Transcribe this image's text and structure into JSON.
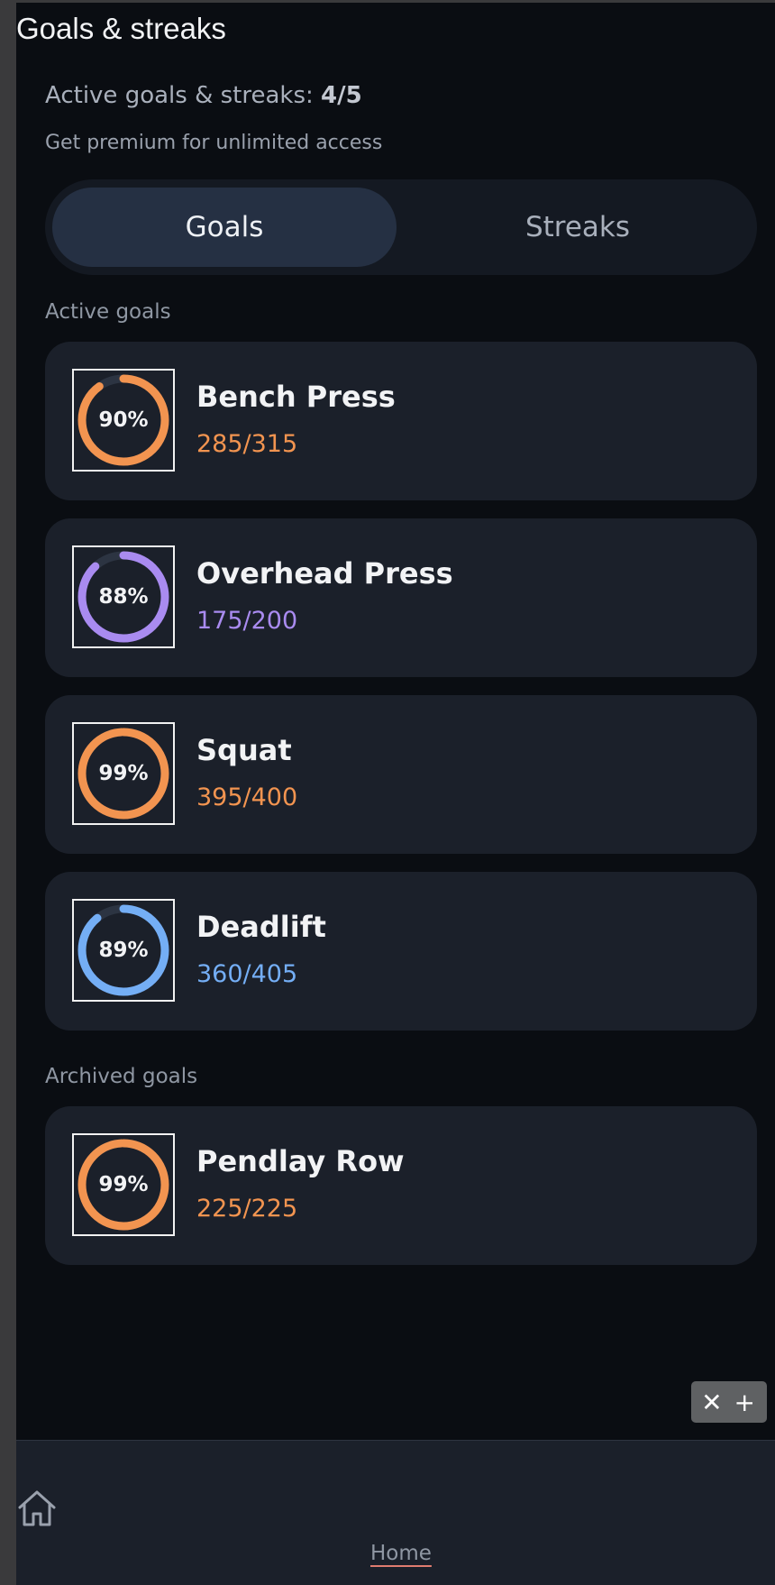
{
  "header": {
    "title": "Goals & streaks"
  },
  "quota": {
    "label": "Active goals & streaks:",
    "value": "4/5"
  },
  "premium_text": "Get premium for unlimited access",
  "tabs": {
    "goals": "Goals",
    "streaks": "Streaks",
    "selected": "Goals"
  },
  "sections": {
    "active": "Active goals",
    "archived": "Archived goals"
  },
  "active_goals": [
    {
      "name": "Bench Press",
      "value": "285/315",
      "percent_label": "90%",
      "progress": 0.9,
      "color": "#f29450"
    },
    {
      "name": "Overhead Press",
      "value": "175/200",
      "percent_label": "88%",
      "progress": 0.88,
      "color": "#a98bf0"
    },
    {
      "name": "Squat",
      "value": "395/400",
      "percent_label": "99%",
      "progress": 0.99,
      "color": "#f29450"
    },
    {
      "name": "Deadlift",
      "value": "360/405",
      "percent_label": "89%",
      "progress": 0.89,
      "color": "#74aef5"
    }
  ],
  "archived_goals": [
    {
      "name": "Pendlay Row",
      "value": "225/225",
      "percent_label": "99%",
      "progress": 0.99,
      "color": "#f29450"
    }
  ],
  "fab": {
    "label": "✕ +"
  },
  "nav": {
    "home_label": "Home",
    "home_icon": "home-icon"
  },
  "colors": {
    "ring_track": "#2c3442",
    "background": "#0a0d12",
    "card": "#1b202a"
  }
}
